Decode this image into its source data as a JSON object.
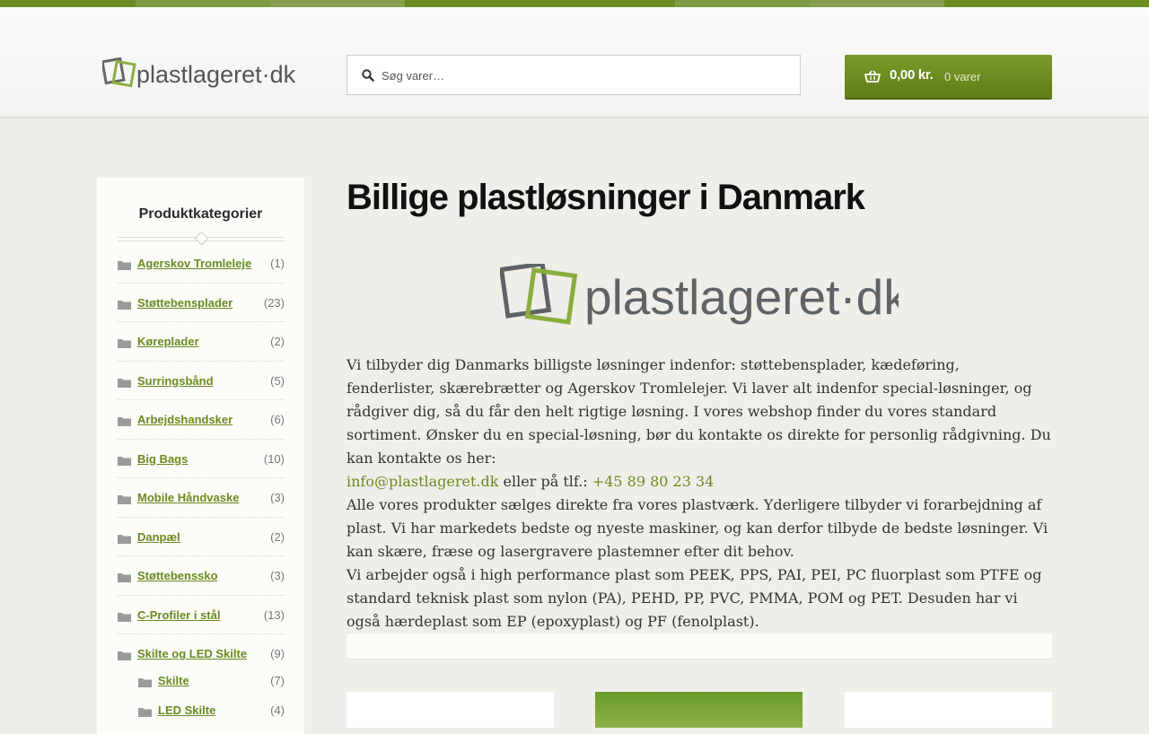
{
  "colors": {
    "accent": "#6a8a1f",
    "cart_bg": "#6b8b1f",
    "stripe": [
      "#6d8c24",
      "#7f9a44",
      "#88a04e",
      "#6d8c24",
      "#6d8c24",
      "#7f9a44",
      "#88a04e",
      "#6d8c24"
    ]
  },
  "header": {
    "logo_text": "plastlageret·dk",
    "search": {
      "placeholder": "Søg varer…",
      "icon": "search-icon"
    },
    "cart": {
      "amount": "0,00 kr.",
      "count": "0 varer",
      "icon": "basket-icon"
    }
  },
  "sidebar": {
    "title": "Produktkategorier",
    "categories": [
      {
        "label": "Agerskov Tromleleje",
        "count": "(1)"
      },
      {
        "label": "Støttebensplader",
        "count": "(23)"
      },
      {
        "label": "Køreplader",
        "count": "(2)"
      },
      {
        "label": "Surringsbånd",
        "count": "(5)"
      },
      {
        "label": "Arbejdshandsker",
        "count": "(6)"
      },
      {
        "label": "Big Bags",
        "count": "(10)"
      },
      {
        "label": "Mobile Håndvaske",
        "count": "(3)"
      },
      {
        "label": "Danpæl",
        "count": "(2)"
      },
      {
        "label": "Støttebenssko",
        "count": "(3)"
      },
      {
        "label": "C-Profiler i stål",
        "count": "(13)"
      },
      {
        "label": "Skilte og LED Skilte",
        "count": "(9)"
      }
    ],
    "subcategories": [
      {
        "label": "Skilte",
        "count": "(7)"
      },
      {
        "label": "LED Skilte",
        "count": "(4)"
      }
    ]
  },
  "main": {
    "title": "Billige plastløsninger i Danmark",
    "logo_text": "plastlageret·dk",
    "paragraph1": "Vi tilbyder dig Danmarks billigste løsninger indenfor: støttebensplader, kædeføring, fenderlister, skærebrætter og Agerskov Tromlelejer. Vi laver alt indenfor special-løsninger, og rådgiver dig, så du får den helt rigtige løsning. I vores webshop finder du vores standard sortiment. Ønsker du en special-løsning, bør du kontakte os direkte for personlig rådgivning. Du kan kontakte os her:",
    "email": "info@plastlageret.dk",
    "phone_prefix": " eller på tlf.: ",
    "phone": "+45 89 80 23 34",
    "paragraph2": "Alle vores produkter sælges direkte fra vores plastværk. Yderligere tilbyder vi forarbejdning af plast. Vi har markedets bedste og nyeste maskiner, og kan derfor tilbyde de bedste løsninger. Vi kan skære, fræse og lasergravere plastemner efter dit behov.",
    "paragraph3": "Vi arbejder også i high performance plast som PEEK, PPS, PAI, PEI, PC fluorplast som PTFE og standard teknisk plast som nylon (PA), PEHD, PP, PVC, PMMA, POM og PET. Desuden har vi også hærdeplast som EP (epoxyplast) og PF (fenolplast)."
  }
}
